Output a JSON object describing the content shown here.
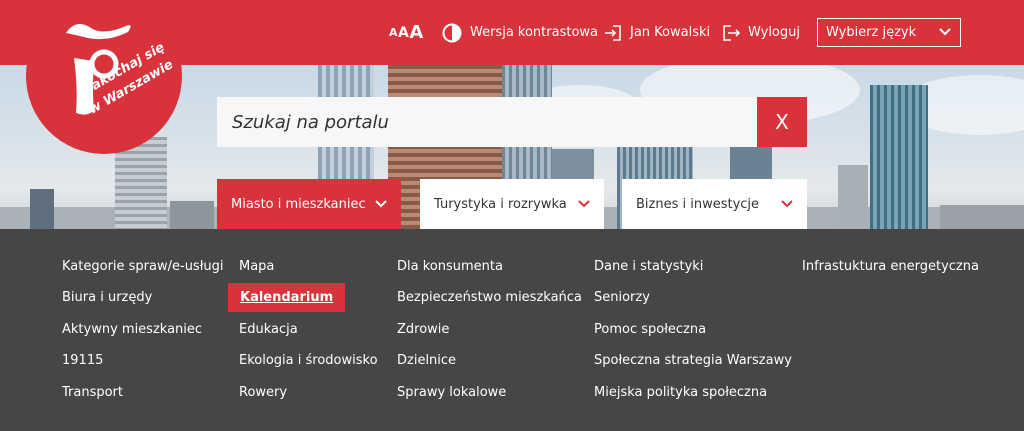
{
  "logo": {
    "text": "zakochaj się w Warszawie"
  },
  "header": {
    "font_size_label": "AAA",
    "contrast_label": "Wersja kontrastowa",
    "user_label": "Jan Kowalski",
    "logout_label": "Wyloguj",
    "language_select": "Wybierz język"
  },
  "search": {
    "placeholder": "Szukaj na portalu",
    "close_label": "X"
  },
  "categories": [
    {
      "label": "Miasto i mieszkaniec",
      "active": true
    },
    {
      "label": "Turystyka i rozrywka",
      "active": false
    },
    {
      "label": "Biznes i inwestycje",
      "active": false
    }
  ],
  "menu": {
    "columns": [
      [
        "Kategorie spraw/e-usługi",
        "Biura i urzędy",
        "Aktywny mieszkaniec",
        "19115",
        "Transport"
      ],
      [
        "Mapa",
        "Kalendarium",
        "Edukacja",
        "Ekologia i środowisko",
        "Rowery"
      ],
      [
        "Dla konsumenta",
        "Bezpieczeństwo mieszkańca",
        "Zdrowie",
        "Dzielnice",
        "Sprawy lokalowe"
      ],
      [
        "Dane i statystyki",
        "Seniorzy",
        "Pomoc społeczna",
        "Społeczna strategia Warszawy",
        "Miejska polityka społeczna"
      ],
      [
        "Infrastuktura energetyczna"
      ]
    ],
    "highlighted": "Kalendarium"
  },
  "colors": {
    "brand_red": "#d8333a",
    "menu_bg": "#464646"
  }
}
